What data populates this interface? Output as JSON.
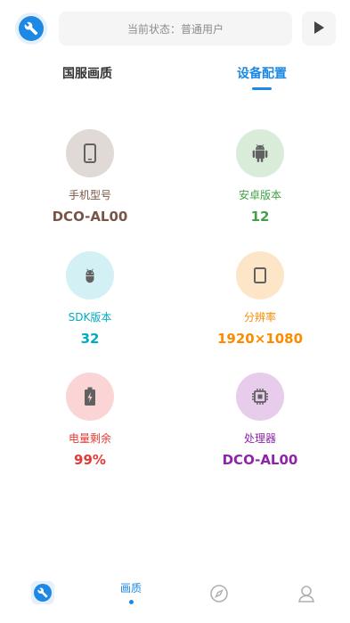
{
  "header": {
    "status_text": "当前状态：普通用户"
  },
  "tabs": [
    {
      "label": "国服画质",
      "active": false
    },
    {
      "label": "设备配置",
      "active": true
    }
  ],
  "device_info": [
    {
      "label": "手机型号",
      "value": "DCO-AL00",
      "icon": "phone-icon",
      "color": "#795548",
      "bg": "#e0d9d5"
    },
    {
      "label": "安卓版本",
      "value": "12",
      "icon": "android-icon",
      "color": "#43a047",
      "bg": "#d9ecd9"
    },
    {
      "label": "SDK版本",
      "value": "32",
      "icon": "android-icon",
      "color": "#00acc1",
      "bg": "#d3f0f5"
    },
    {
      "label": "分辨率",
      "value": "1920×1080",
      "icon": "tablet-icon",
      "color": "#fb8c00",
      "bg": "#fde6c8"
    },
    {
      "label": "电量剩余",
      "value": "99%",
      "icon": "battery-icon",
      "color": "#e53935",
      "bg": "#fbd5d5"
    },
    {
      "label": "处理器",
      "value": "DCO-AL00",
      "icon": "cpu-icon",
      "color": "#8e24aa",
      "bg": "#e7cdeb"
    }
  ],
  "bottom_nav": [
    {
      "label": "",
      "icon": "wrench-icon"
    },
    {
      "label": "画质",
      "icon": "",
      "active": true
    },
    {
      "label": "",
      "icon": "compass-icon"
    },
    {
      "label": "",
      "icon": "user-icon"
    }
  ]
}
